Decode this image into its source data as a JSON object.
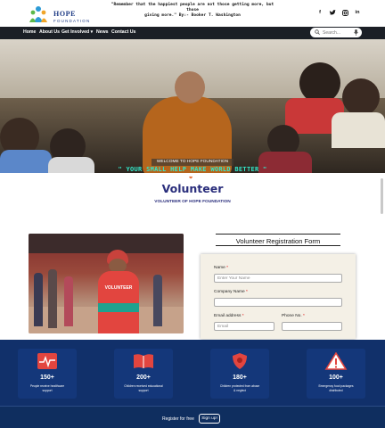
{
  "header": {
    "logo_title": "HOPE",
    "logo_subtitle": "FOUNDATION",
    "quote_line1": "\"Remember that the happiest people are not those getting more, but those",
    "quote_line2": "giving more.\" By:- Booker T. Washington",
    "social": [
      "f",
      "t",
      "ig",
      "in"
    ]
  },
  "nav": {
    "items": [
      "Home",
      "About Us",
      "Get Involved",
      "News",
      "Contact Us"
    ],
    "dropdown_indicator": "▾",
    "search_placeholder": "Search..."
  },
  "hero": {
    "welcome": "WELCOME TO HOPE FOUNDATION",
    "slogan": "\" YOUR SMALL HELP MAKE WORLD BETTER \""
  },
  "volunteer": {
    "heart": "❤",
    "title": "Volunteer",
    "subtitle": "VOLUNTEER OF HOPE FOUNDATION",
    "shirt_text": "VOLUNTEER"
  },
  "form": {
    "title": "Volunteer Registration Form",
    "required_mark": "*",
    "name_label": "Name",
    "name_placeholder": "Enter Your Name",
    "company_label": "Company Name",
    "email_label": "Email address",
    "email_placeholder": "Email",
    "phone_label": "Phone No."
  },
  "stats": [
    {
      "icon": "heartbeat-icon",
      "value": "150+",
      "label_line1": "People receive healthcare",
      "label_line2": "support"
    },
    {
      "icon": "book-icon",
      "value": "200+",
      "label_line1": "Children received educational",
      "label_line2": "support"
    },
    {
      "icon": "shield-icon",
      "value": "180+",
      "label_line1": "Children protected from abuse",
      "label_line2": "& neglect"
    },
    {
      "icon": "warning-icon",
      "value": "100+",
      "label_line1": "Emergency food packages",
      "label_line2": "distributed"
    }
  ],
  "footer": {
    "register_text": "Register for free",
    "signup_label": "Sign up!"
  },
  "colors": {
    "nav_bg": "#1b1f26",
    "brand_blue": "#2a2e7c",
    "slogan": "#34e6c8",
    "stats_bg": "#11306a",
    "icon_red": "#e2453f"
  }
}
